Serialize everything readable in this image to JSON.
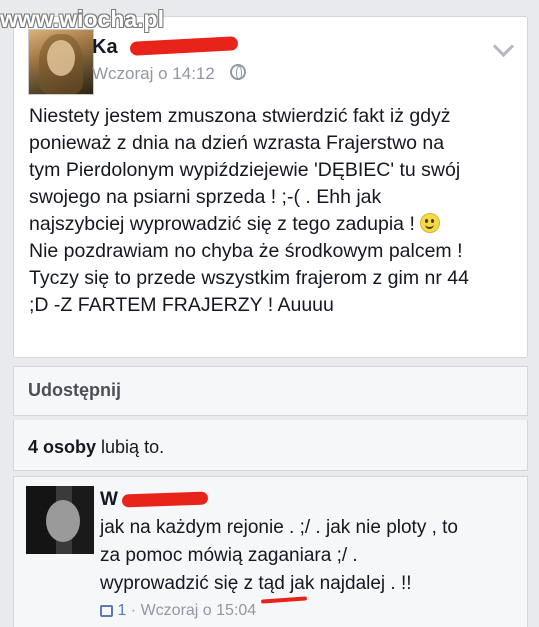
{
  "watermark": "www.wiocha.pl",
  "post": {
    "author": "Ka",
    "time": "Wczoraj o 14:12",
    "privacy_icon": "globe-icon",
    "menu_icon": "chevron-down-icon",
    "text_before_emoji": "Niestety jestem zmuszona stwierdzić fakt iż gdyż\nponieważ z dnia na dzień wzrasta Frajerstwo na\ntym Pierdolonym wypiździejewie 'DĘBIEC' tu swój\nswojego na psiarni sprzeda ! ;-( . Ehh jak\nnajszybciej wyprowadzić się z tego zadupia ! ",
    "emoji": "smiley-icon",
    "text_after_emoji": "\nNie pozdrawiam no chyba że środkowym palcem !\nTyczy się to przede wszystkim frajerom z gim nr 44\n;D -Z FARTEM FRAJERZY ! Auuuu"
  },
  "share": {
    "label": "Udostępnij"
  },
  "likes": {
    "count": "4 osoby",
    "suffix": " lubią to."
  },
  "comment": {
    "author": "W",
    "text": "jak na każdym rejonie . ;/ . jak nie ploty , to\nza pomoc mówią zaganiara ;/ .\nwyprowadzić się z tąd jak najdalej . !!",
    "like_count": "1",
    "separator": " · ",
    "time": "Wczoraj o 15:04"
  },
  "colors": {
    "background": "#e9eaed",
    "redaction": "#e8231a",
    "meta": "#9197a3"
  }
}
